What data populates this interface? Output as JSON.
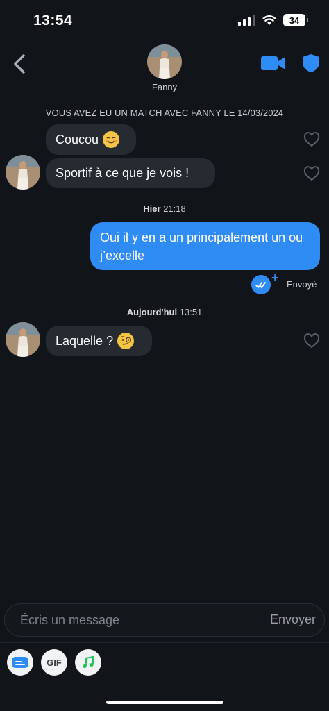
{
  "status_bar": {
    "time": "13:54",
    "battery": "34"
  },
  "header": {
    "contact_name": "Fanny"
  },
  "match_banner": "VOUS AVEZ EU UN MATCH AVEC FANNY LE 14/03/2024",
  "messages": [
    {
      "text": "Coucou"
    },
    {
      "text": "Sportif à ce que je vois !"
    },
    {
      "day": "Hier",
      "time": "21:18"
    },
    {
      "text": "Oui il y en a un principalement un ou j’excelle",
      "status": "Envoyé"
    },
    {
      "day": "Aujourd'hui",
      "time": "13:51"
    },
    {
      "text": "Laquelle ?"
    }
  ],
  "composer": {
    "placeholder": "Écris un message",
    "send_label": "Envoyer"
  },
  "toolbar": {
    "gif_label": "GIF"
  },
  "colors": {
    "accent": "#2f8cf5",
    "background": "#111418",
    "bubble_in": "#262a31"
  }
}
